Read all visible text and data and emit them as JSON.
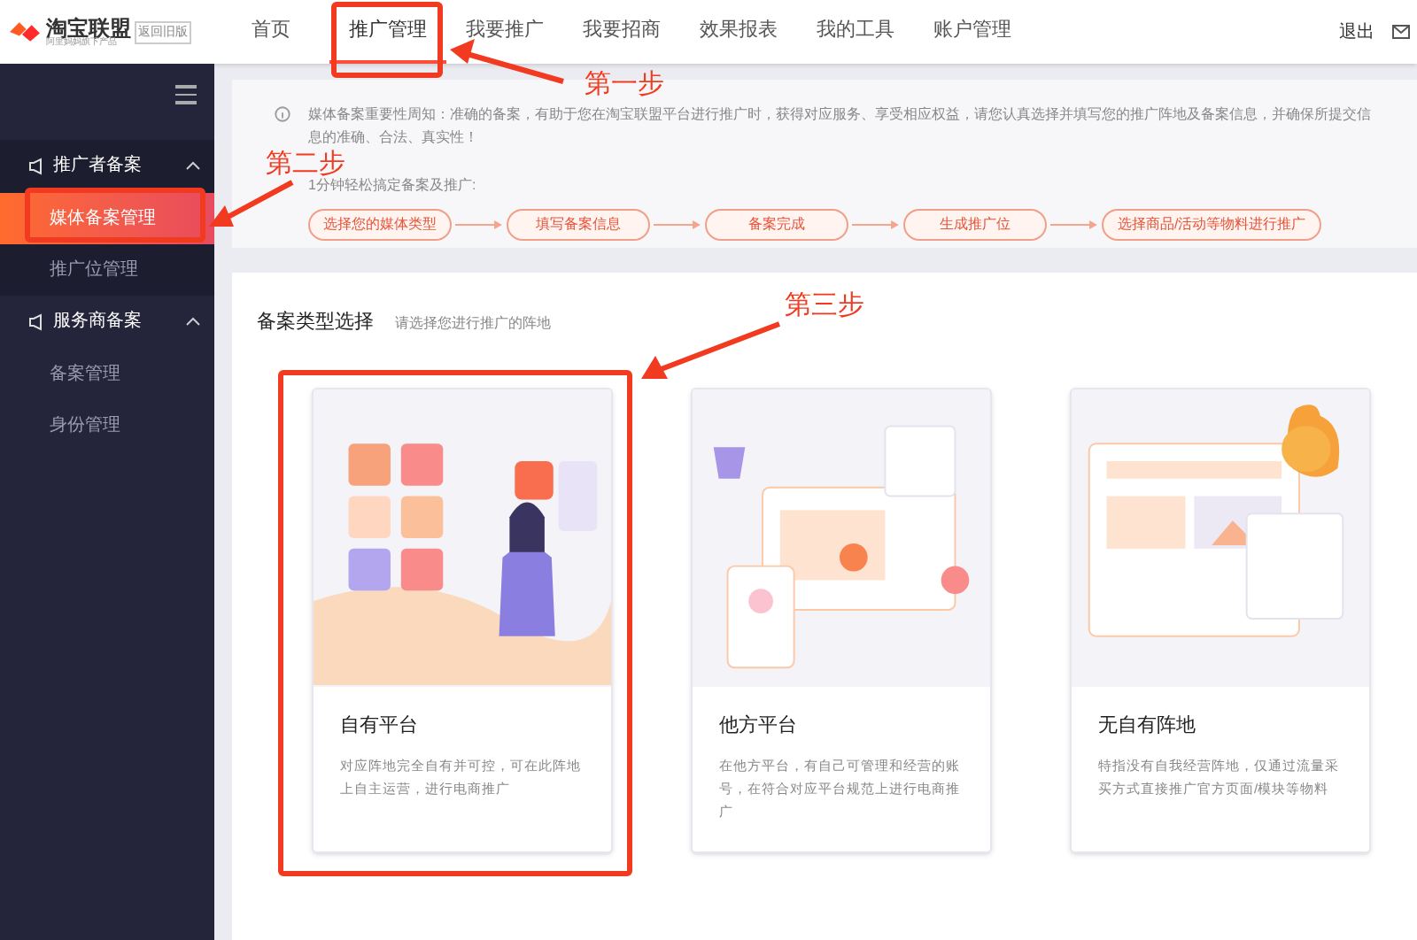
{
  "header": {
    "logo_text": "淘宝联盟",
    "tagline": "阿里妈妈旗下产品",
    "back_button": "返回旧版",
    "nav": [
      {
        "label": "首页",
        "selected": false
      },
      {
        "label": "推广管理",
        "selected": true
      },
      {
        "label": "我要推广",
        "selected": false
      },
      {
        "label": "我要招商",
        "selected": false
      },
      {
        "label": "效果报表",
        "selected": false
      },
      {
        "label": "我的工具",
        "selected": false
      },
      {
        "label": "账户管理",
        "selected": false
      }
    ],
    "logout": "退出"
  },
  "sidebar": {
    "groups": [
      {
        "label": "推广者备案",
        "expanded": true,
        "children": [
          {
            "label": "媒体备案管理",
            "selected": true
          },
          {
            "label": "推广位管理",
            "selected": false
          }
        ]
      },
      {
        "label": "服务商备案",
        "expanded": true,
        "children": [
          {
            "label": "备案管理",
            "selected": false
          },
          {
            "label": "身份管理",
            "selected": false
          }
        ]
      }
    ]
  },
  "notice": {
    "text": "媒体备案重要性周知：准确的备案，有助于您在淘宝联盟平台进行推广时，获得对应服务、享受相应权益，请您认真选择并填写您的推广阵地及备案信息，并确保所提交信息的准确、合法、真实性！",
    "steps_intro": "1分钟轻松搞定备案及推广:",
    "steps": [
      "选择您的媒体类型",
      "填写备案信息",
      "备案完成",
      "生成推广位",
      "选择商品/活动等物料进行推广"
    ]
  },
  "section": {
    "title": "备案类型选择",
    "subtitle": "请选择您进行推广的阵地",
    "cards": [
      {
        "kind": "own",
        "title": "自有平台",
        "description": "对应阵地完全自有并可控，可在此阵地上自主运营，进行电商推广"
      },
      {
        "kind": "other",
        "title": "他方平台",
        "description": "在他方平台，有自己可管理和经营的账号，在符合对应平台规范上进行电商推广"
      },
      {
        "kind": "none",
        "title": "无自有阵地",
        "description": "特指没有自我经营阵地，仅通过流量采买方式直接推广官方页面/模块等物料"
      }
    ]
  },
  "annotations": [
    "第一步",
    "第二步",
    "第三步"
  ]
}
